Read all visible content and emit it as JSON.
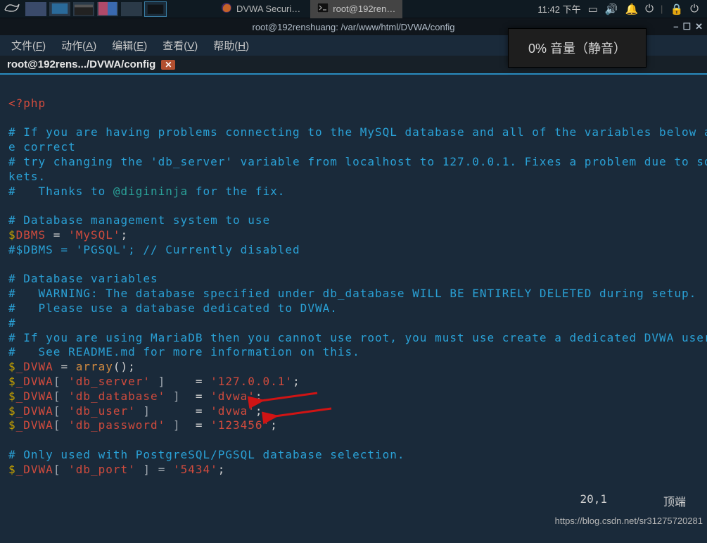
{
  "topbar": {
    "task1": "DVWA Securi…",
    "task2": "root@192ren…",
    "clock": "11:42 下午"
  },
  "window_title": "root@192renshuang: /var/www/html/DVWA/config",
  "volume_popup": "0% 音量（静音）",
  "menubar": {
    "file": "文件(",
    "file_u": "F",
    "file2": ")",
    "action": "动作(",
    "action_u": "A",
    "action2": ")",
    "edit": "编辑(",
    "edit_u": "E",
    "edit2": ")",
    "view": "查看(",
    "view_u": "V",
    "view2": ")",
    "help": "帮助(",
    "help_u": "H",
    "help2": ")"
  },
  "tab": {
    "label": "root@192rens.../DVWA/config",
    "close": "✕"
  },
  "code": {
    "l1": "<?php",
    "l2a": "# If you are having problems connecting to the MySQL database and all of the variables below ar",
    "l2b": "e correct",
    "l3a": "# try changing the 'db_server' variable from localhost to 127.0.0.1. Fixes a problem due to soc",
    "l3b": "kets.",
    "l4a": "#   Thanks to ",
    "l4b": "@digininja",
    "l4c": " for the fix.",
    "l5": "# Database management system to use",
    "l6a": "$",
    "l6b": "DBMS",
    "l6c": " = ",
    "l6d": "'MySQL'",
    "l6e": ";",
    "l7": "#$DBMS = 'PGSQL'; // Currently disabled",
    "l8": "# Database variables",
    "l9": "#   WARNING: The database specified under db_database WILL BE ENTIRELY DELETED during setup.",
    "l10": "#   Please use a database dedicated to DVWA.",
    "l11": "#",
    "l12": "# If you are using MariaDB then you cannot use root, you must use create a dedicated DVWA user.",
    "l13": "#   See README.md for more information on this.",
    "arr_eq": " = ",
    "arr_fn": "array",
    "arr_p": "();",
    "dvwa": "_DVWA",
    "dollar": "$",
    "br_o": "[ ",
    "br_c": " ]",
    "eq": " = ",
    "semi": ";",
    "k1": "'db_server'",
    "sp1": "   ",
    "v1": "'127.0.0.1'",
    "k2": "'db_database'",
    "sp2": " ",
    "v2": "'dvwa'",
    "k3": "'db_user'",
    "sp3": "     ",
    "v3": "'dvwa'",
    "k4": "'db_password'",
    "sp4": " ",
    "v4": "'123456'",
    "cmt_pg": "# Only used with PostgreSQL/PGSQL database selection.",
    "k5": "'db_port'",
    "sp5": " ",
    "v5": "'5434'",
    "br_c5": "] = "
  },
  "status": {
    "pos": "20,1",
    "where": "顶端"
  },
  "watermark": "https://blog.csdn.net/sr31275720281"
}
